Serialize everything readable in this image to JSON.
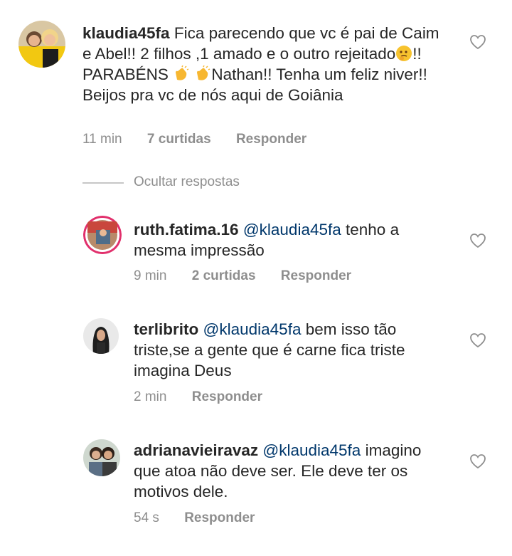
{
  "comments": [
    {
      "username": "klaudia45fa",
      "parts": {
        "a": "Fica parecendo que  vc é pai de Caim e Abel!! 2 filhos ,1 amado e o outro rejeitado",
        "b": "!! PARABÉNS ",
        "c": " ",
        "d": "Nathan!! Tenha um feliz niver!! Beijos pra vc de nós aqui de Goiânia"
      },
      "time": "11 min",
      "likes": "7 curtidas",
      "reply": "Responder",
      "emojis": [
        "thinking-face",
        "clapping-hands",
        "clapping-hands"
      ]
    },
    {
      "username": "ruth.fatima.16",
      "mention": "@klaudia45fa",
      "body": "tenho a mesma impressão",
      "time": "9 min",
      "likes": "2 curtidas",
      "reply": "Responder"
    },
    {
      "username": "terlibrito",
      "mention": "@klaudia45fa",
      "body": "bem isso tão triste,se a gente que é carne fica triste imagina Deus",
      "time": "2 min",
      "reply": "Responder"
    },
    {
      "username": "adrianavieiravaz",
      "mention": "@klaudia45fa",
      "body": "imagino que atoa não deve ser. Ele deve ter os motivos dele.",
      "time": "54 s",
      "reply": "Responder"
    }
  ],
  "hide_replies": "Ocultar respostas",
  "colors": {
    "text": "#262626",
    "meta": "#8e8e8e",
    "mention": "#00376b",
    "divider": "#c7c7c7"
  },
  "icons": {
    "like": "heart-outline-icon"
  }
}
